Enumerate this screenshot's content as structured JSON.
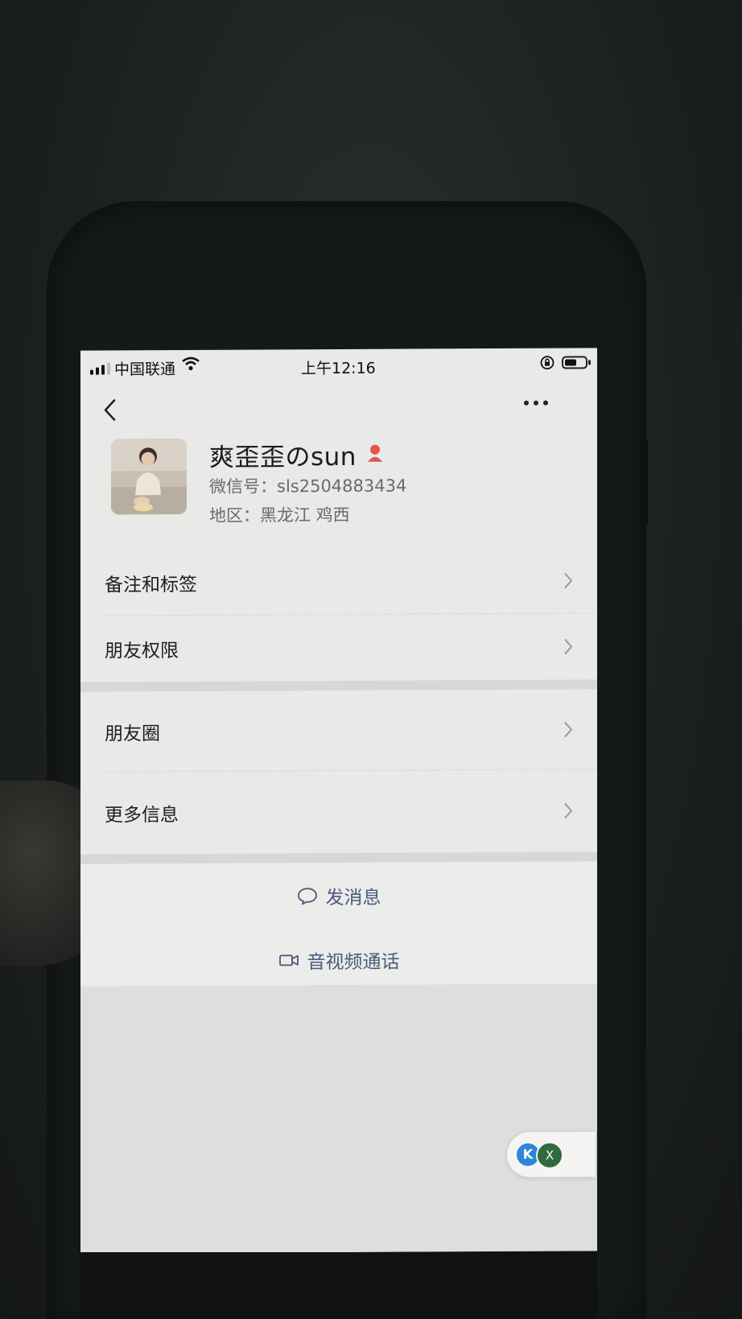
{
  "status_bar": {
    "carrier": "中国联通",
    "time": "上午12:16"
  },
  "profile": {
    "name": "爽歪歪のsun",
    "wechat_id": "微信号：sls2504883434",
    "region": "地区：黑龙江 鸡西"
  },
  "menu_group_1": [
    {
      "label": "备注和标签"
    },
    {
      "label": "朋友权限"
    }
  ],
  "menu_group_2": [
    {
      "label": "朋友圈"
    },
    {
      "label": "更多信息"
    }
  ],
  "actions": {
    "send_message": "发消息",
    "av_call": "音视频通话"
  },
  "floating_bubble": {
    "left_badge": "K",
    "right_badge": "X"
  },
  "colors": {
    "action_text": "#4b5a7e",
    "female_badge": "#e2574c",
    "screen_bg": "#e9e9e7"
  }
}
